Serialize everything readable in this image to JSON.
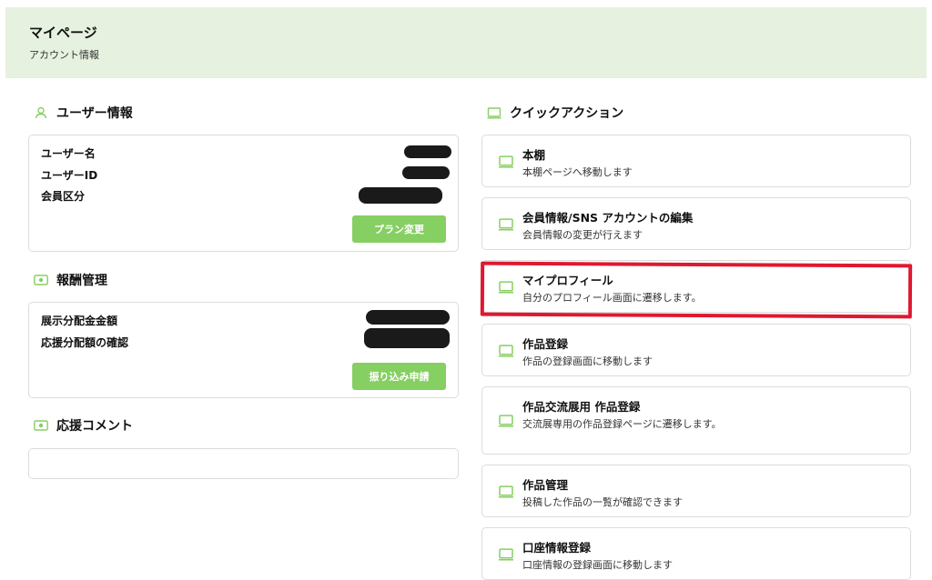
{
  "header": {
    "title": "マイページ",
    "subtitle": "アカウント情報"
  },
  "user_info": {
    "heading": "ユーザー情報",
    "rows": [
      {
        "label": "ユーザー名"
      },
      {
        "label": "ユーザーID"
      },
      {
        "label": "会員区分"
      }
    ],
    "plan_button": "プラン変更"
  },
  "reward": {
    "heading": "報酬管理",
    "rows": [
      {
        "label": "展示分配金金額"
      },
      {
        "label": "応援分配額の確認"
      }
    ],
    "transfer_button": "振り込み申請"
  },
  "support_comment": {
    "heading": "応援コメント"
  },
  "quick_actions": {
    "heading": "クイックアクション",
    "items": [
      {
        "title": "本棚",
        "desc": "本棚ページへ移動します"
      },
      {
        "title": "会員情報/SNS アカウントの編集",
        "desc": "会員情報の変更が行えます"
      },
      {
        "title": "マイプロフィール",
        "desc": "自分のプロフィール画面に遷移します。"
      },
      {
        "title": "作品登録",
        "desc": "作品の登録画面に移動します"
      },
      {
        "title": "作品交流展用 作品登録",
        "desc": "交流展専用の作品登録ページに遷移します。"
      },
      {
        "title": "作品管理",
        "desc": "投稿した作品の一覧が確認できます"
      },
      {
        "title": "口座情報登録",
        "desc": "口座情報の登録画面に移動します"
      }
    ]
  },
  "colors": {
    "accent_green": "#86cf62",
    "header_bg": "#e6f1df",
    "highlight_red": "#e01830"
  }
}
